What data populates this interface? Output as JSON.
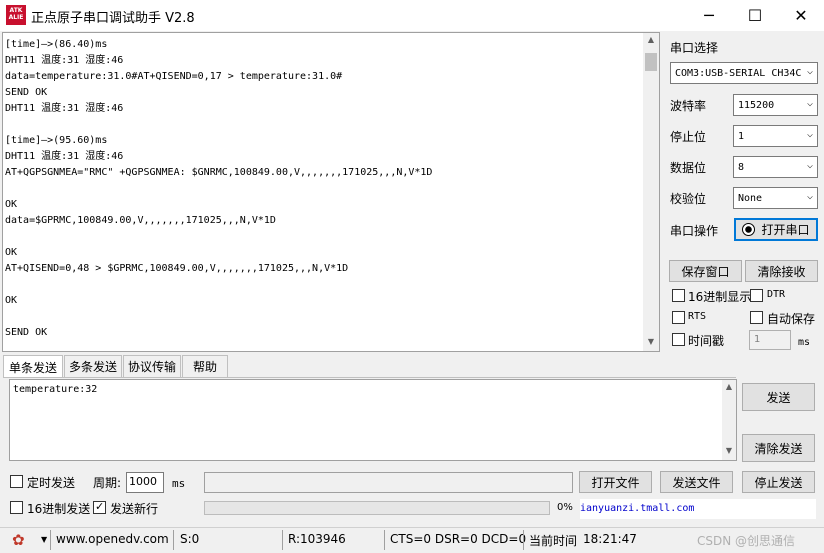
{
  "window": {
    "logo_text": "ATK ALIENTEK",
    "title": "正点原子串口调试助手 V2.8",
    "minimize_glyph": "─",
    "maximize_glyph": "☐",
    "close_glyph": "✕"
  },
  "receive": {
    "text": "[time]—>(86.40)ms\nDHT11 温度:31 湿度:46\ndata=temperature:31.0#AT+QISEND=0,17 > temperature:31.0#\nSEND OK\nDHT11 温度:31 湿度:46\n\n[time]—>(95.60)ms\nDHT11 温度:31 湿度:46\nAT+QGPSGNMEA=\"RMC\" +QGPSGNMEA: $GNRMC,100849.00,V,,,,,,,171025,,,N,V*1D\n\nOK\ndata=$GPRMC,100849.00,V,,,,,,,171025,,,N,V*1D\n\nOK\nAT+QISEND=0,48 > $GPRMC,100849.00,V,,,,,,,171025,,,N,V*1D\n\nOK\n\nSEND OK"
  },
  "settings": {
    "port_select_label": "串口选择",
    "port_value": "COM3:USB-SERIAL CH34C",
    "baud_label": "波特率",
    "baud_value": "115200",
    "stop_label": "停止位",
    "stop_value": "1",
    "data_label": "数据位",
    "data_value": "8",
    "parity_label": "校验位",
    "parity_value": "None",
    "serial_op_label": "串口操作",
    "open_port_label": "打开串口",
    "save_window_label": "保存窗口",
    "clear_receive_label": "清除接收",
    "hex_display_label": "16进制显示",
    "dtr_label": "DTR",
    "rts_label": "RTS",
    "auto_save_label": "自动保存",
    "timestamp_label": "时间戳",
    "timestamp_value": "1",
    "ms_label": "ms"
  },
  "tabs": [
    "单条发送",
    "多条发送",
    "协议传输",
    "帮助"
  ],
  "send": {
    "text": "temperature:32",
    "send_label": "发送",
    "clear_send_label": "清除发送",
    "timed_send_label": "定时发送",
    "period_label": "周期:",
    "period_value": "1000",
    "period_unit": "ms",
    "open_file_label": "打开文件",
    "send_file_label": "发送文件",
    "stop_send_label": "停止发送",
    "hex_send_label": "16进制发送",
    "newline_label": "发送新行",
    "progress_text": "0%",
    "progress": 0,
    "link_text": "ianyuanzi.tmall.com"
  },
  "status": {
    "website": "www.openedv.com",
    "sent": "S:0",
    "received": "R:103946",
    "lines": "CTS=0 DSR=0 DCD=0",
    "time_label": "当前时间",
    "time_value": "18:21:47",
    "watermark": "CSDN @创思通信"
  }
}
